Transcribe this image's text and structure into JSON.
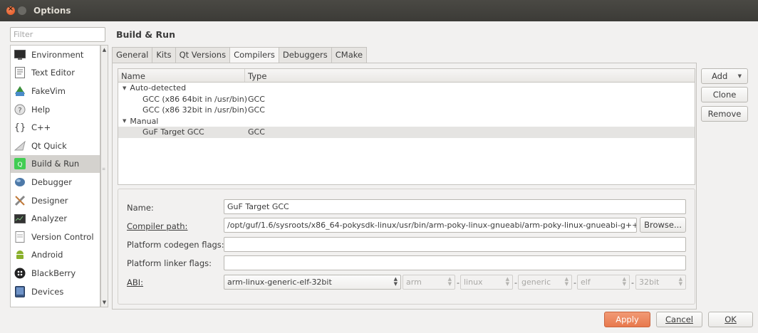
{
  "window": {
    "title": "Options"
  },
  "filter": {
    "placeholder": "Filter"
  },
  "sidebar": {
    "items": [
      {
        "label": "Environment",
        "icon": "environment-icon"
      },
      {
        "label": "Text Editor",
        "icon": "text-editor-icon"
      },
      {
        "label": "FakeVim",
        "icon": "fakevim-icon"
      },
      {
        "label": "Help",
        "icon": "help-icon"
      },
      {
        "label": "C++",
        "icon": "cpp-icon"
      },
      {
        "label": "Qt Quick",
        "icon": "qt-quick-icon"
      },
      {
        "label": "Build & Run",
        "icon": "build-run-icon",
        "selected": true
      },
      {
        "label": "Debugger",
        "icon": "debugger-icon"
      },
      {
        "label": "Designer",
        "icon": "designer-icon"
      },
      {
        "label": "Analyzer",
        "icon": "analyzer-icon"
      },
      {
        "label": "Version Control",
        "icon": "version-control-icon"
      },
      {
        "label": "Android",
        "icon": "android-icon"
      },
      {
        "label": "BlackBerry",
        "icon": "blackberry-icon"
      },
      {
        "label": "Devices",
        "icon": "devices-icon"
      }
    ]
  },
  "page": {
    "title": "Build & Run"
  },
  "tabs": [
    "General",
    "Kits",
    "Qt Versions",
    "Compilers",
    "Debuggers",
    "CMake"
  ],
  "active_tab": "Compilers",
  "tree": {
    "headers": {
      "name": "Name",
      "type": "Type"
    },
    "groups": [
      {
        "label": "Auto-detected",
        "items": [
          {
            "name": "GCC (x86 64bit in /usr/bin)",
            "type": "GCC"
          },
          {
            "name": "GCC (x86 32bit in /usr/bin)",
            "type": "GCC"
          }
        ]
      },
      {
        "label": "Manual",
        "items": [
          {
            "name": "GuF Target GCC",
            "type": "GCC",
            "selected": true
          }
        ]
      }
    ]
  },
  "buttons": {
    "add": "Add",
    "clone": "Clone",
    "remove": "Remove",
    "browse": "Browse...",
    "apply": "Apply",
    "cancel": "Cancel",
    "ok": "OK"
  },
  "form": {
    "name_label": "Name:",
    "name_value": "GuF Target GCC",
    "path_label": "Compiler path:",
    "path_value": "/opt/guf/1.6/sysroots/x86_64-pokysdk-linux/usr/bin/arm-poky-linux-gnueabi/arm-poky-linux-gnueabi-g++",
    "codegen_label": "Platform codegen flags:",
    "codegen_value": "",
    "linker_label": "Platform linker flags:",
    "linker_value": "",
    "abi_label": "ABI:",
    "abi_value": "arm-linux-generic-elf-32bit",
    "abi_parts": [
      "arm",
      "linux",
      "generic",
      "elf",
      "32bit"
    ]
  }
}
